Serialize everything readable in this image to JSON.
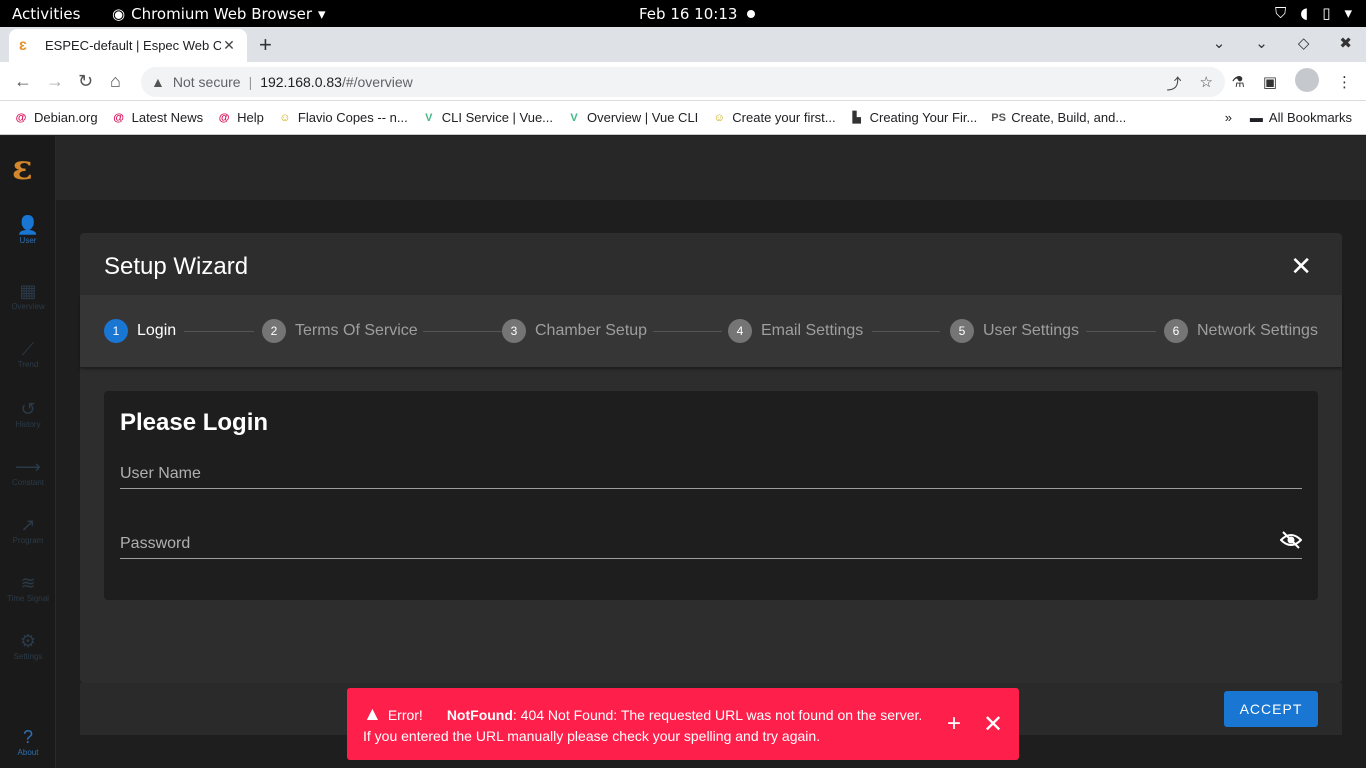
{
  "os": {
    "activities": "Activities",
    "app_name": "Chromium Web Browser",
    "clock": "Feb 16  10:13"
  },
  "browser": {
    "tab_title": "ESPEC-default | Espec Web C",
    "url_warning": "Not secure",
    "url_host": "192.168.0.83",
    "url_path": "/#/overview",
    "bookmarks": [
      {
        "label": "Debian.org",
        "icon": "debian-icon"
      },
      {
        "label": "Latest News",
        "icon": "debian-icon"
      },
      {
        "label": "Help",
        "icon": "debian-icon"
      },
      {
        "label": "Flavio Copes -- n...",
        "icon": "flavio-icon"
      },
      {
        "label": "CLI Service | Vue...",
        "icon": "vue-icon"
      },
      {
        "label": "Overview | Vue CLI",
        "icon": "vue-icon"
      },
      {
        "label": "Create your first...",
        "icon": "flavio-icon"
      },
      {
        "label": "Creating Your Fir...",
        "icon": "bookmark-icon"
      },
      {
        "label": "Create, Build, and...",
        "icon": "ps-icon"
      }
    ],
    "all_bookmarks": "All Bookmarks"
  },
  "sidebar": {
    "items": [
      {
        "label": "User",
        "icon": "user-icon"
      },
      {
        "label": "Overview",
        "icon": "dashboard-icon"
      },
      {
        "label": "Trend",
        "icon": "trend-icon"
      },
      {
        "label": "History",
        "icon": "history-icon"
      },
      {
        "label": "Constant",
        "icon": "constant-icon"
      },
      {
        "label": "Program",
        "icon": "program-icon"
      },
      {
        "label": "Time Signal",
        "icon": "signal-icon"
      },
      {
        "label": "Settings",
        "icon": "gear-icon"
      },
      {
        "label": "About",
        "icon": "help-icon"
      }
    ]
  },
  "dialog": {
    "title": "Setup Wizard",
    "steps": [
      {
        "num": "1",
        "label": "Login"
      },
      {
        "num": "2",
        "label": "Terms Of Service"
      },
      {
        "num": "3",
        "label": "Chamber Setup"
      },
      {
        "num": "4",
        "label": "Email Settings"
      },
      {
        "num": "5",
        "label": "User Settings"
      },
      {
        "num": "6",
        "label": "Network Settings"
      }
    ],
    "active_step": 1,
    "login": {
      "heading": "Please Login",
      "username_placeholder": "User Name",
      "password_placeholder": "Password"
    },
    "accept_label": "ACCEPT"
  },
  "snackbar": {
    "prefix": "Error!",
    "error_name": "NotFound",
    "message": ": 404 Not Found: The requested URL was not found on the server.",
    "line2": "If you entered the URL manually please check your spelling and try again."
  },
  "colors": {
    "accent": "#1976d2",
    "error": "#ff1f4b",
    "logo": "#d3862b"
  }
}
